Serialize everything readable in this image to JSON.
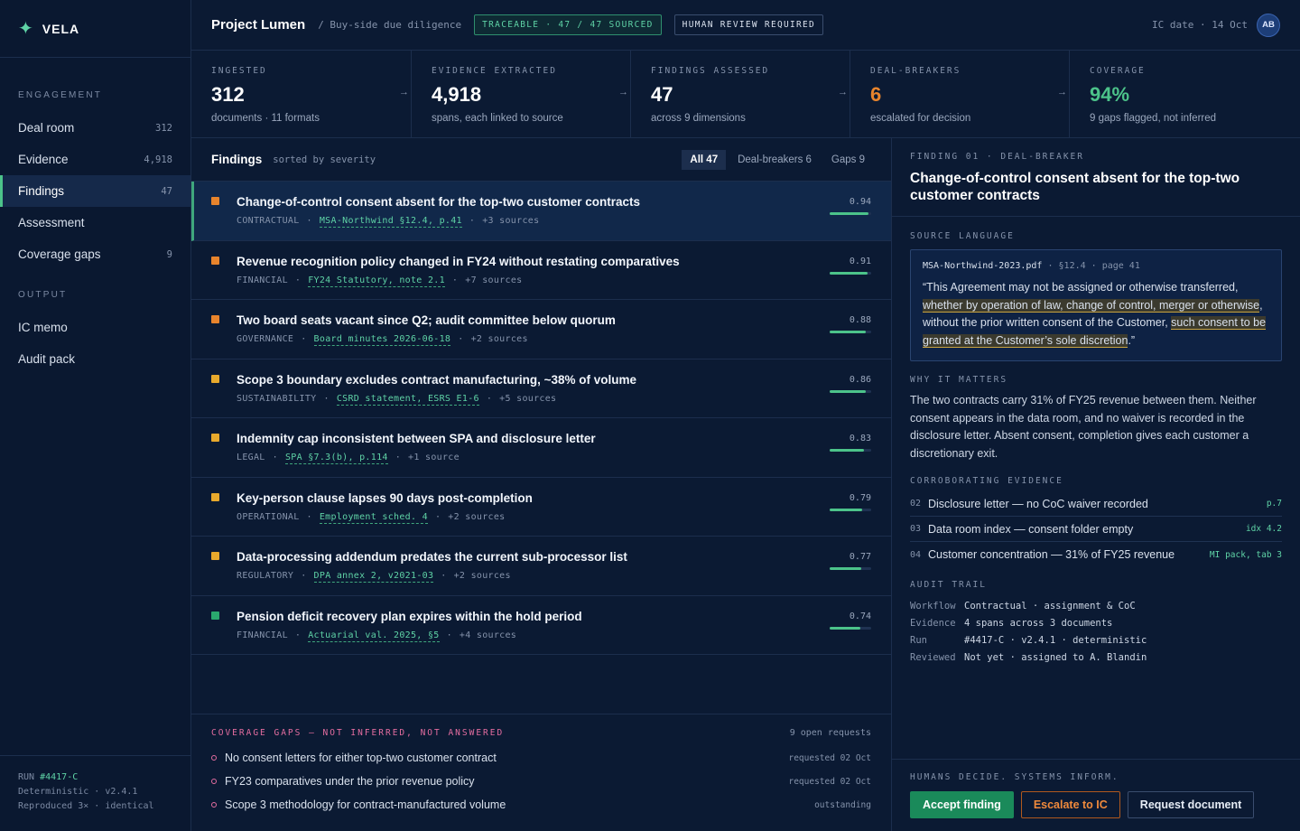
{
  "brand": {
    "name": "VELA",
    "icon": "sparkle-icon"
  },
  "sidebar": {
    "section1": "ENGAGEMENT",
    "items": [
      {
        "label": "Deal room",
        "count": "312"
      },
      {
        "label": "Evidence",
        "count": "4,918"
      },
      {
        "label": "Findings",
        "count": "47"
      },
      {
        "label": "Assessment",
        "count": ""
      },
      {
        "label": "Coverage gaps",
        "count": "9"
      }
    ],
    "section2": "OUTPUT",
    "output_items": [
      {
        "label": "IC memo"
      },
      {
        "label": "Audit pack"
      }
    ],
    "footer": {
      "run_label": "RUN",
      "run_id": "#4417-C",
      "line2": "Deterministic · v2.4.1",
      "line3": "Reproduced 3× · identical"
    }
  },
  "header": {
    "title": "Project Lumen",
    "subtitle": "/ Buy-side due diligence",
    "badge_trace": "TRACEABLE · 47 / 47 SOURCED",
    "badge_human": "HUMAN REVIEW REQUIRED",
    "ic_date": "IC date · 14 Oct",
    "avatar": "AB"
  },
  "metrics": [
    {
      "label": "INGESTED",
      "value": "312",
      "sub": "documents · 11 formats"
    },
    {
      "label": "EVIDENCE EXTRACTED",
      "value": "4,918",
      "sub": "spans, each linked to source"
    },
    {
      "label": "FINDINGS ASSESSED",
      "value": "47",
      "sub": "across 9 dimensions"
    },
    {
      "label": "DEAL-BREAKERS",
      "value": "6",
      "sub": "escalated for decision"
    },
    {
      "label": "COVERAGE",
      "value": "94%",
      "sub": "9 gaps flagged, not inferred"
    }
  ],
  "findings": {
    "title": "Findings",
    "sort": "sorted by severity",
    "tabs": [
      "All 47",
      "Deal-breakers 6",
      "Gaps 9"
    ],
    "rows": [
      {
        "title": "Change-of-control consent absent for the top-two customer contracts",
        "category": "CONTRACTUAL",
        "source": "MSA-Northwind §12.4, p.41",
        "more": "+3 sources",
        "score": "0.94",
        "score_value": 0.94,
        "severity_color": "#e8842c"
      },
      {
        "title": "Revenue recognition policy changed in FY24 without restating comparatives",
        "category": "FINANCIAL",
        "source": "FY24 Statutory, note 2.1",
        "more": "+7 sources",
        "score": "0.91",
        "score_value": 0.91,
        "severity_color": "#e8842c"
      },
      {
        "title": "Two board seats vacant since Q2; audit committee below quorum",
        "category": "GOVERNANCE",
        "source": "Board minutes 2026-06-18",
        "more": "+2 sources",
        "score": "0.88",
        "score_value": 0.88,
        "severity_color": "#e8842c"
      },
      {
        "title": "Scope 3 boundary excludes contract manufacturing, ~38% of volume",
        "category": "SUSTAINABILITY",
        "source": "CSRD statement, ESRS E1-6",
        "more": "+5 sources",
        "score": "0.86",
        "score_value": 0.86,
        "severity_color": "#e8a92c"
      },
      {
        "title": "Indemnity cap inconsistent between SPA and disclosure letter",
        "category": "LEGAL",
        "source": "SPA §7.3(b), p.114",
        "more": "+1 source",
        "score": "0.83",
        "score_value": 0.83,
        "severity_color": "#e8a92c"
      },
      {
        "title": "Key-person clause lapses 90 days post-completion",
        "category": "OPERATIONAL",
        "source": "Employment sched. 4",
        "more": "+2 sources",
        "score": "0.79",
        "score_value": 0.79,
        "severity_color": "#e8a92c"
      },
      {
        "title": "Data-processing addendum predates the current sub-processor list",
        "category": "REGULATORY",
        "source": "DPA annex 2, v2021-03",
        "more": "+2 sources",
        "score": "0.77",
        "score_value": 0.77,
        "severity_color": "#e8a92c"
      },
      {
        "title": "Pension deficit recovery plan expires within the hold period",
        "category": "FINANCIAL",
        "source": "Actuarial val. 2025, §5",
        "more": "+4 sources",
        "score": "0.74",
        "score_value": 0.74,
        "severity_color": "#2aa86e"
      }
    ]
  },
  "gaps": {
    "title": "COVERAGE GAPS — NOT INFERRED, NOT ANSWERED",
    "count": "9 open requests",
    "items": [
      {
        "text": "No consent letters for either top-two customer contract",
        "status": "requested 02 Oct"
      },
      {
        "text": "FY23 comparatives under the prior revenue policy",
        "status": "requested 02 Oct"
      },
      {
        "text": "Scope 3 methodology for contract-manufactured volume",
        "status": "outstanding"
      }
    ]
  },
  "detail": {
    "label": "FINDING 01 · DEAL-BREAKER",
    "title": "Change-of-control consent absent for the top-two customer contracts",
    "source_section": "SOURCE LANGUAGE",
    "quote_doc": "MSA-Northwind-2023.pdf",
    "quote_loc": "§12.4 · page 41",
    "quote_parts": [
      "“This Agreement may not be assigned or otherwise transferred, ",
      "whether by operation of law, change of control, merger or otherwise",
      ", without the prior written consent of the Customer, ",
      "such consent to be granted at the Customer’s sole discretion",
      ".”"
    ],
    "why_section": "WHY IT MATTERS",
    "why_text": "The two contracts carry 31% of FY25 revenue between them. Neither consent appears in the data room, and no waiver is recorded in the disclosure letter. Absent consent, completion gives each customer a discretionary exit.",
    "corr_section": "CORROBORATING EVIDENCE",
    "evidence": [
      {
        "num": "02",
        "text": "Disclosure letter — no CoC waiver recorded",
        "ref": "p.7"
      },
      {
        "num": "03",
        "text": "Data room index — consent folder empty",
        "ref": "idx 4.2"
      },
      {
        "num": "04",
        "text": "Customer concentration — 31% of FY25 revenue",
        "ref": "MI pack, tab 3"
      }
    ],
    "audit_section": "AUDIT TRAIL",
    "audit": [
      {
        "k": "Workflow",
        "v": "Contractual · assignment & CoC"
      },
      {
        "k": "Evidence",
        "v": "4 spans across 3 documents"
      },
      {
        "k": "Run",
        "v": "#4417-C · v2.4.1 · deterministic"
      },
      {
        "k": "Reviewed",
        "v": "Not yet · assigned to A. Blandin"
      }
    ],
    "tagline": "HUMANS DECIDE. SYSTEMS INFORM.",
    "buttons": {
      "accept": "Accept finding",
      "escalate": "Escalate to IC",
      "request": "Request document"
    }
  }
}
